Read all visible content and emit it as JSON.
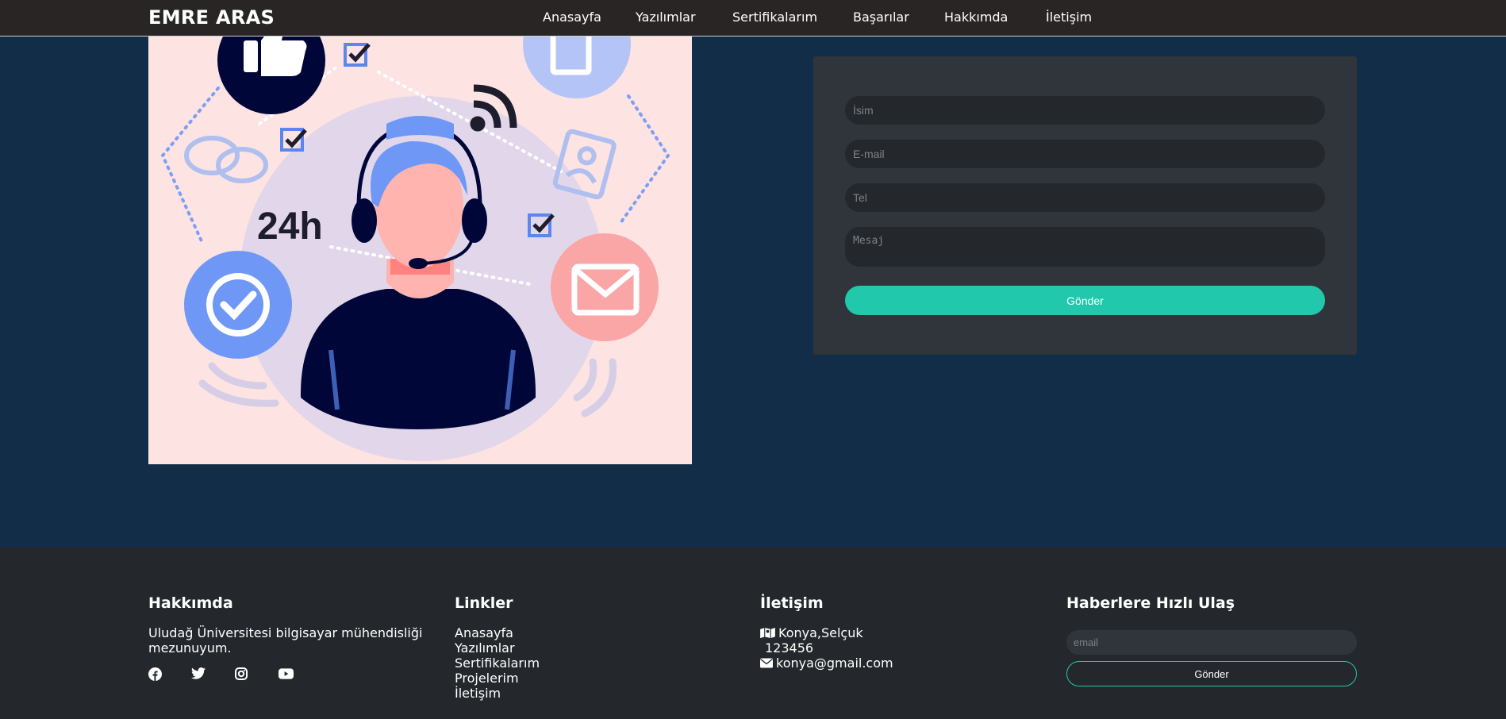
{
  "nav": {
    "brand": "EMRE ARAS",
    "items": [
      "Anasayfa",
      "Yazılımlar",
      "Sertifikalarım",
      "Başarılar",
      "Hakkımda",
      "İletişim"
    ]
  },
  "hero": {
    "badge_text": "24h"
  },
  "contact_form": {
    "name_placeholder": "İsim",
    "email_placeholder": "E-mail",
    "phone_placeholder": "Tel",
    "message_placeholder": "Mesaj",
    "submit_label": "Gönder",
    "accent_color": "#22c8ab"
  },
  "footer": {
    "about": {
      "title": "Hakkımda",
      "text": "Uludağ Üniversitesi bilgisayar mühendisliği mezunuyum.",
      "social_icons": [
        "facebook-icon",
        "twitter-icon",
        "instagram-icon",
        "youtube-icon"
      ]
    },
    "links": {
      "title": "Linkler",
      "items": [
        "Anasayfa",
        "Yazılımlar",
        "Sertifikalarım",
        "Projelerim",
        "İletişim"
      ]
    },
    "contact": {
      "title": "İletişim",
      "address": "Konya,Selçuk",
      "phone": "123456",
      "email": "konya@gmail.com"
    },
    "newsletter": {
      "title": "Haberlere Hızlı Ulaş",
      "placeholder": "email",
      "button_label": "Gönder"
    }
  }
}
